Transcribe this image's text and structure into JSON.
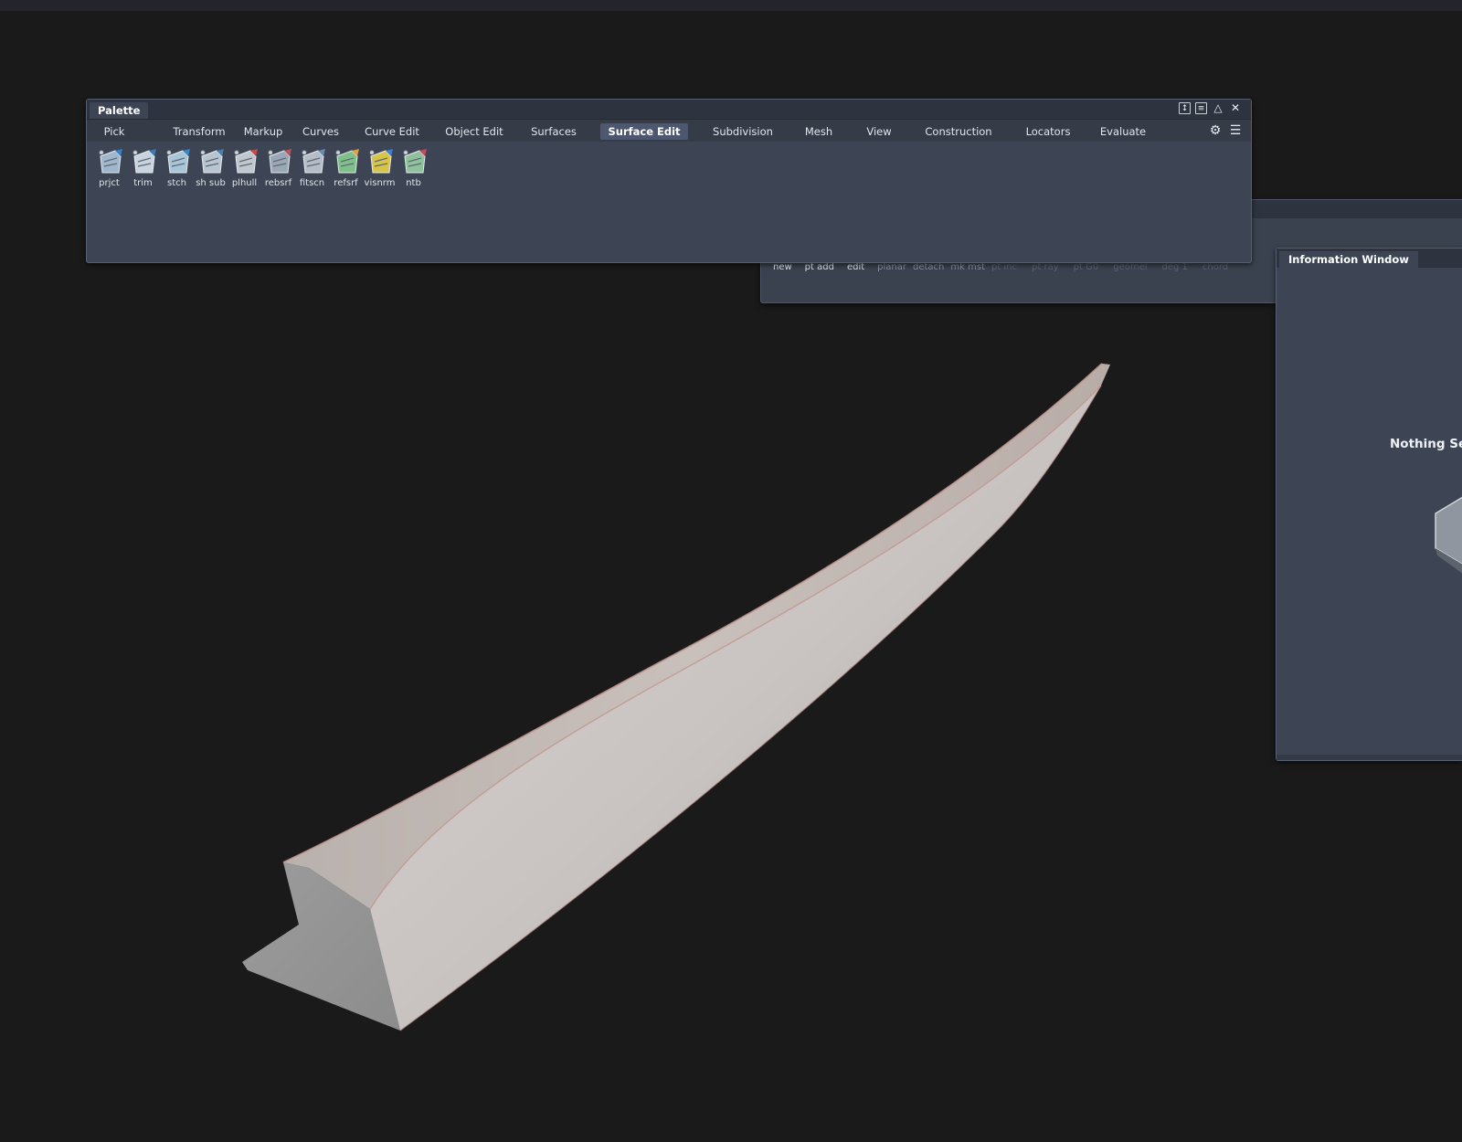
{
  "palette": {
    "title": "Palette",
    "tabs": [
      {
        "label": "Pick",
        "active": false
      },
      {
        "label": "Transform",
        "active": false
      },
      {
        "label": "Markup",
        "active": false
      },
      {
        "label": "Curves",
        "active": false
      },
      {
        "label": "Curve Edit",
        "active": false
      },
      {
        "label": "Object Edit",
        "active": false
      },
      {
        "label": "Surfaces",
        "active": false
      },
      {
        "label": "Surface Edit",
        "active": true
      },
      {
        "label": "Subdivision",
        "active": false
      },
      {
        "label": "Mesh",
        "active": false
      },
      {
        "label": "View",
        "active": false
      },
      {
        "label": "Construction",
        "active": false
      },
      {
        "label": "Locators",
        "active": false
      },
      {
        "label": "Evaluate",
        "active": false
      }
    ],
    "tools": [
      {
        "label": "prjct",
        "icon": "project-icon"
      },
      {
        "label": "trim",
        "icon": "trim-icon"
      },
      {
        "label": "stch",
        "icon": "stitch-icon"
      },
      {
        "label": "sh sub",
        "icon": "shell-subtract-icon"
      },
      {
        "label": "plhull",
        "icon": "planar-hull-icon"
      },
      {
        "label": "rebsrf",
        "icon": "rebuild-surface-icon"
      },
      {
        "label": "fitscn",
        "icon": "fit-section-icon"
      },
      {
        "label": "refsrf",
        "icon": "reflect-surface-icon"
      },
      {
        "label": "visnrm",
        "icon": "visualize-normals-icon"
      },
      {
        "label": "ntb",
        "icon": "ntb-icon"
      }
    ]
  },
  "control_panel": {
    "items": [
      {
        "label": "new",
        "state": "on"
      },
      {
        "label": "pt add",
        "state": "on"
      },
      {
        "label": "edit",
        "state": "on"
      },
      {
        "label": "planar",
        "state": "dim"
      },
      {
        "label": "detach",
        "state": "dim"
      },
      {
        "label": "mk mst",
        "state": "dim"
      },
      {
        "label": "pt inc",
        "state": "off"
      },
      {
        "label": "pt ray",
        "state": "off"
      },
      {
        "label": "pt G0",
        "state": "off"
      },
      {
        "label": "geomel",
        "state": "off"
      },
      {
        "label": "deg 1",
        "state": "off"
      },
      {
        "label": "chord",
        "state": "off"
      }
    ]
  },
  "info_window": {
    "title": "Information Window",
    "status": "Nothing Sele"
  }
}
